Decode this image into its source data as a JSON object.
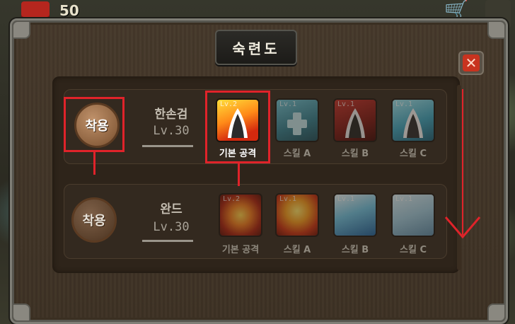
{
  "hud": {
    "count": "50",
    "icons": [
      "flag-icon",
      "cart-icon"
    ]
  },
  "dialog": {
    "title": "숙련도",
    "close_icon": "close-icon"
  },
  "weapons": [
    {
      "name": "한손검",
      "level": "Lv.30",
      "equip_label": "착용",
      "equipped": true,
      "skills": [
        {
          "lv": "Lv.2",
          "label": "기본 공격",
          "theme": "fire-fang",
          "active": true
        },
        {
          "lv": "Lv.1",
          "label": "스킬 A",
          "theme": "teal-cross",
          "active": false
        },
        {
          "lv": "Lv.1",
          "label": "스킬 B",
          "theme": "red-fang",
          "active": false
        },
        {
          "lv": "Lv.1",
          "label": "스킬 C",
          "theme": "ice-fang",
          "active": false
        }
      ]
    },
    {
      "name": "완드",
      "level": "Lv.30",
      "equip_label": "착용",
      "equipped": false,
      "skills": [
        {
          "lv": "Lv.2",
          "label": "기본 공격",
          "theme": "fireball",
          "active": false
        },
        {
          "lv": "Lv.1",
          "label": "스킬 A",
          "theme": "flame-burst",
          "active": false
        },
        {
          "lv": "Lv.1",
          "label": "스킬 B",
          "theme": "ice-shard",
          "active": false
        },
        {
          "lv": "Lv.1",
          "label": "스킬 C",
          "theme": "frost-field",
          "active": false
        }
      ]
    }
  ],
  "colors": {
    "highlight": "#e0232a",
    "frame": "#7f7e76",
    "panel": "#2e241a"
  }
}
